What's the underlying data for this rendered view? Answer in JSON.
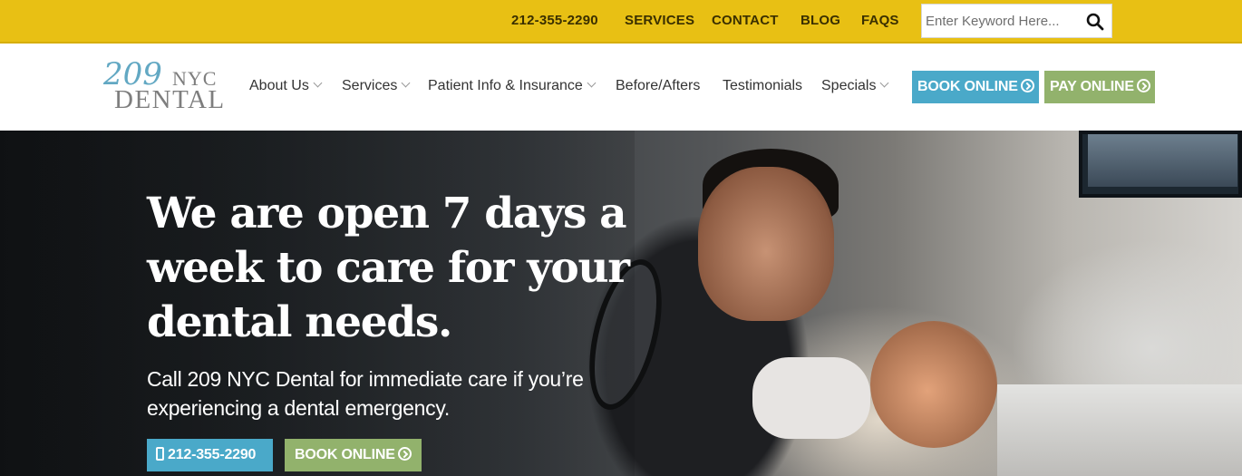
{
  "topbar": {
    "phone": "212-355-2290",
    "links": [
      "SERVICES",
      "CONTACT",
      "BLOG",
      "FAQS"
    ],
    "search_placeholder": "Enter Keyword Here..."
  },
  "logo": {
    "number": "209",
    "city": "NYC",
    "word": "DENTAL"
  },
  "nav": {
    "items": [
      {
        "label": "About Us",
        "dropdown": true
      },
      {
        "label": "Services",
        "dropdown": true
      },
      {
        "label": "Patient Info & Insurance",
        "dropdown": true
      },
      {
        "label": "Before/Afters",
        "dropdown": false
      },
      {
        "label": "Testimonials",
        "dropdown": false
      },
      {
        "label": "Specials",
        "dropdown": true
      }
    ],
    "book_label": "BOOK ONLINE",
    "pay_label": "PAY ONLINE"
  },
  "hero": {
    "headline": "We are open 7 days a week to care for your dental needs.",
    "subtext": "Call 209 NYC Dental for immediate care if you’re experiencing a dental emergency.",
    "call_label": "212-355-2290",
    "book_label": "BOOK ONLINE"
  },
  "colors": {
    "topbar": "#e8c014",
    "blue_button": "#4aa9c9",
    "green_button": "#92b26c",
    "logo_blue": "#62a8c3"
  },
  "icons": {
    "search": "search-icon",
    "arrow": "arrow-circle-right-icon",
    "phone": "mobile-phone-icon",
    "chevron": "chevron-down-icon"
  }
}
